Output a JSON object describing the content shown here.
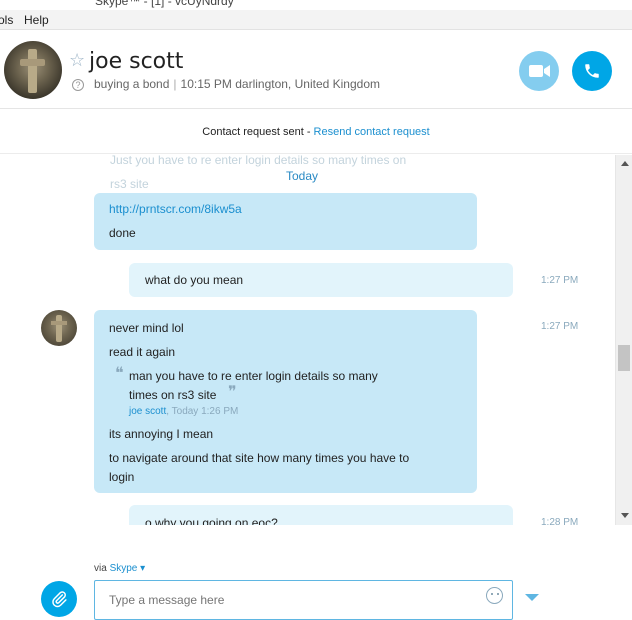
{
  "window": {
    "title": "Skype™ - [1] - vcUyNdrdy"
  },
  "menu": {
    "items": [
      "ols",
      "Help"
    ]
  },
  "contact": {
    "name": "joe scott",
    "mood": "buying a bond",
    "local_time": "10:15 PM darlington, United Kingdom"
  },
  "request": {
    "text": "Contact request sent - ",
    "link": "Resend contact request"
  },
  "conversation": {
    "ghost_text": "Just you have to re enter login details so many times on",
    "ghost_text_2": "rs3 site",
    "date_divider": "Today",
    "messages": [
      {
        "from": "them",
        "lines": [
          "http://prntscr.com/8ikw5a",
          "done"
        ],
        "time": ""
      },
      {
        "from": "me",
        "lines": [
          "what do you mean"
        ],
        "time": "1:27 PM"
      },
      {
        "from": "them",
        "lines": [
          "never mind lol",
          "read it again"
        ],
        "quote": {
          "lines": [
            "man you have to re enter login details so many",
            "times on rs3 site"
          ],
          "author": "joe scott",
          "when": ", Today 1:26 PM"
        },
        "after_lines": [
          "its annoying I mean",
          "to navigate around that site how many times you have to",
          "login"
        ],
        "time": "1:27 PM"
      },
      {
        "from": "me",
        "lines": [
          "o why you going on eoc?"
        ],
        "time": "1:28 PM"
      }
    ]
  },
  "composer": {
    "via_label": "via ",
    "via_service": "Skype",
    "placeholder": "Type a message here"
  },
  "colors": {
    "accent": "#00a6e6",
    "incoming_bubble": "#c7e8f7",
    "outgoing_bubble": "#e2f4fb"
  },
  "icons": [
    "star-icon",
    "question-icon",
    "video-call-icon",
    "audio-call-icon",
    "paperclip-icon",
    "emoji-icon",
    "chevron-down-icon",
    "quote-open-icon",
    "quote-close-icon"
  ]
}
